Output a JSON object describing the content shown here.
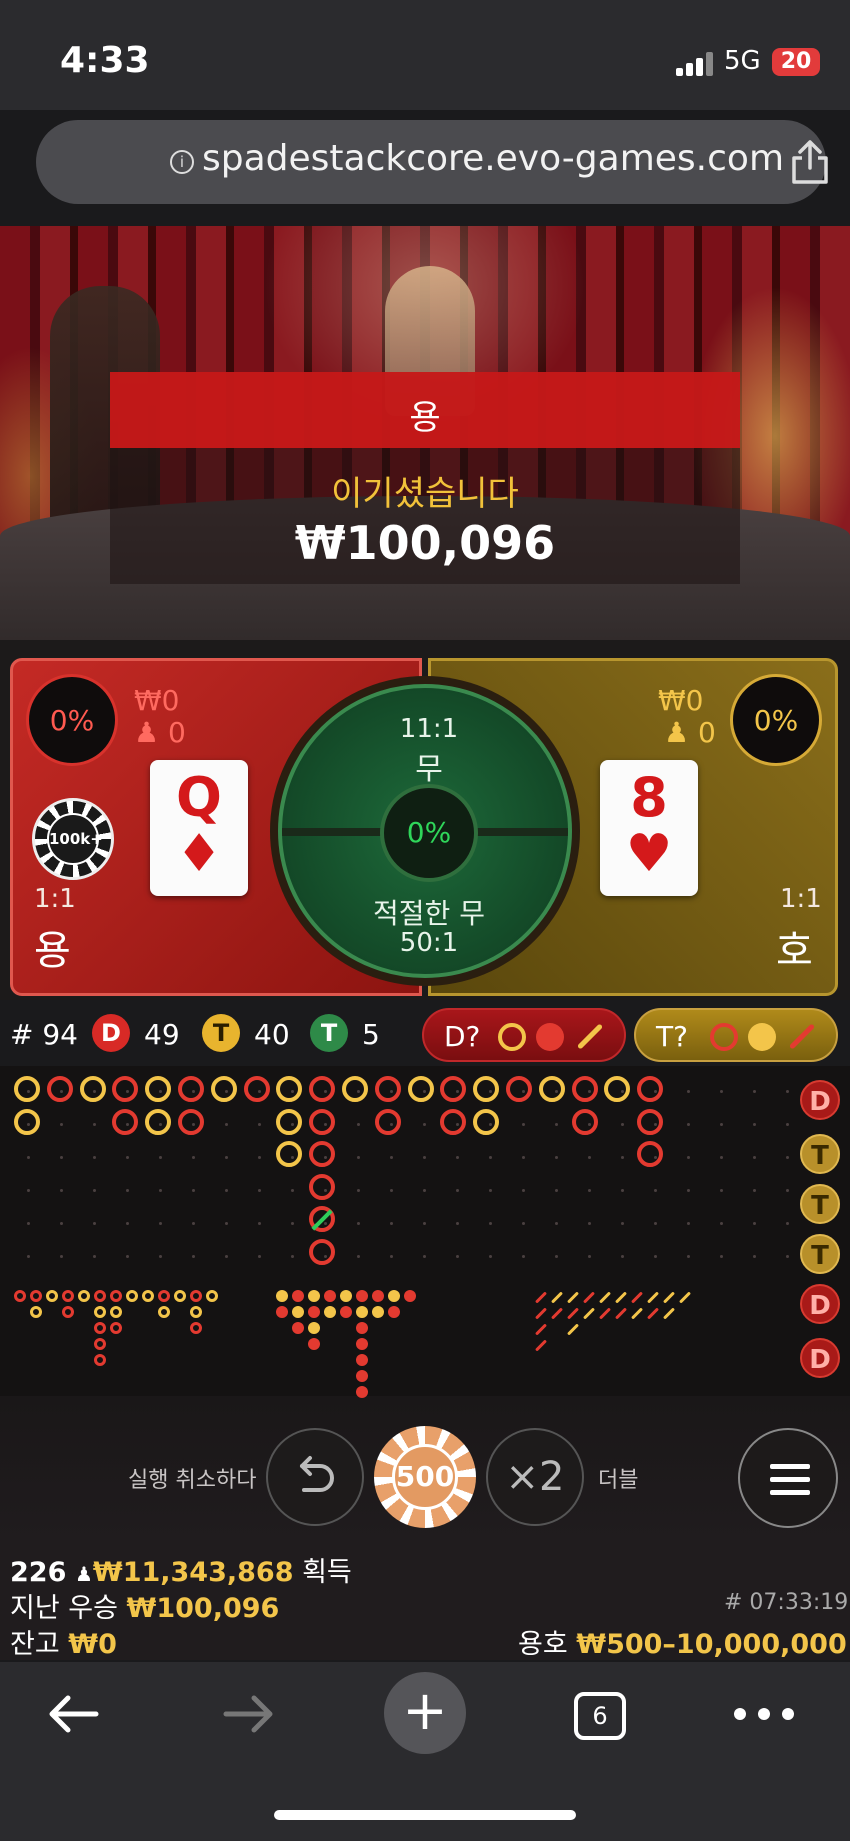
{
  "status_bar": {
    "time": "4:33",
    "network": "5G",
    "battery": "20"
  },
  "browser": {
    "url": "spadestackcore.evo-games.com",
    "tabs_count": "6"
  },
  "result": {
    "winner": "용",
    "message": "이기셨습니다",
    "amount": "₩100,096"
  },
  "dragon": {
    "name": "용",
    "percent": "0%",
    "stake": "₩0",
    "players": "0",
    "odds": "1:1",
    "card": {
      "rank": "Q",
      "suit": "♦"
    },
    "chip_label": "100k+"
  },
  "tiger": {
    "name": "호",
    "percent": "0%",
    "stake": "₩0",
    "players": "0",
    "odds": "1:1",
    "card": {
      "rank": "8",
      "suit": "♥"
    }
  },
  "tie": {
    "odds": "11:1",
    "label": "무",
    "percent": "0%",
    "suited_label": "적절한 무",
    "suited_odds": "50:1"
  },
  "stats": {
    "rounds_label": "# 94",
    "dragon_badge": "D",
    "dragon_count": "49",
    "tiger_badge": "T",
    "tiger_count": "40",
    "tie_badge": "T",
    "tie_count": "5"
  },
  "predict": {
    "dragon": "D?",
    "tiger": "T?"
  },
  "roadmap_side": [
    "D",
    "T",
    "T",
    "T",
    "D",
    "D"
  ],
  "controls": {
    "undo_label": "실행 취소하다",
    "undo_icon": "undo-icon",
    "chip_value": "500",
    "double_icon": "×2",
    "double_label": "더블"
  },
  "info": {
    "players_count": "226",
    "total_win": "₩11,343,868",
    "total_win_label": "획득",
    "last_win_label": "지난 우승",
    "last_win": "₩100,096",
    "balance_label": "잔고",
    "balance": "₩0",
    "round_id": "# 07:33:19",
    "limits_label": "용호",
    "limits": "₩500–10,000,000"
  },
  "colors": {
    "dragon": "#c42a25",
    "tiger": "#8a6e1a",
    "tie": "#1d6a3a",
    "gold": "#f3c54a"
  }
}
